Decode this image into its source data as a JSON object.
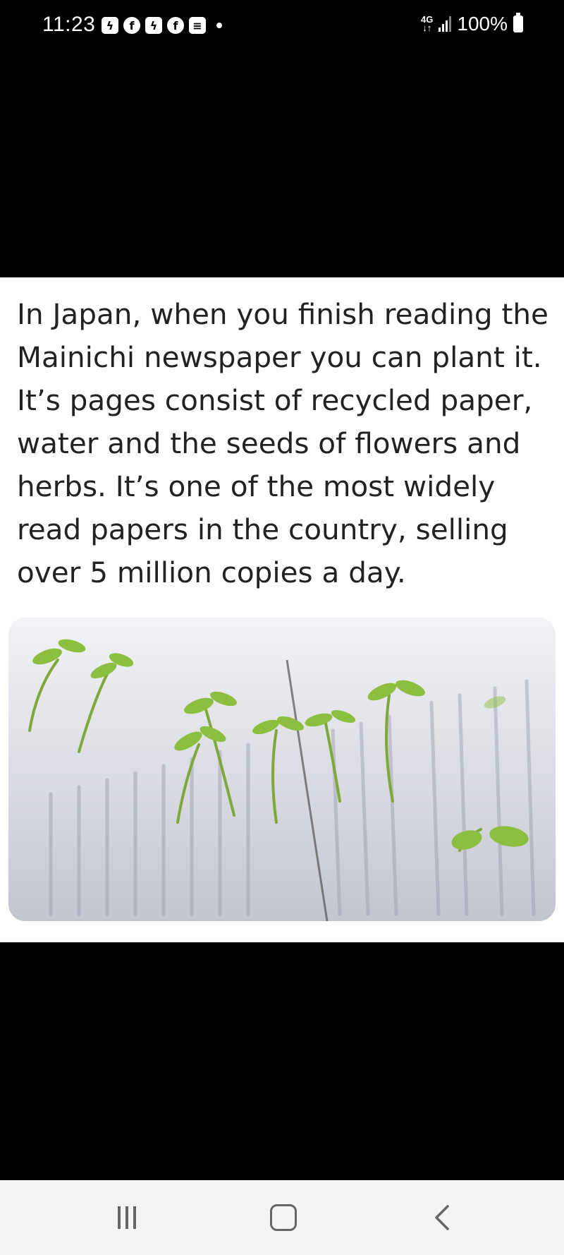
{
  "status_bar": {
    "time": "11:23",
    "battery": "100%",
    "network": "4G",
    "network_arrows": "↓↑",
    "notification_icons": [
      "messenger-icon",
      "facebook-icon",
      "messenger-icon",
      "facebook-icon",
      "news-icon",
      "dot-icon"
    ]
  },
  "post": {
    "text": "In Japan, when you finish reading the Mainichi newspaper you can plant it. It’s pages consist of recycled paper, water and the seeds of flowers and herbs. It’s one of the most widely read papers in the country, selling over 5 million copies a day."
  },
  "nav_bar": {
    "buttons": [
      "recents-icon",
      "home-icon",
      "back-icon"
    ]
  }
}
